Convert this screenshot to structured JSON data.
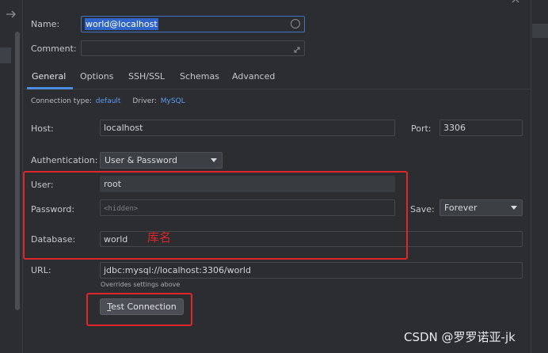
{
  "dialog": {
    "name_label": "Name:",
    "name_value": "world@localhost",
    "comment_label": "Comment:",
    "comment_value": ""
  },
  "tabs": [
    {
      "label": "General",
      "active": true
    },
    {
      "label": "Options",
      "active": false
    },
    {
      "label": "SSH/SSL",
      "active": false
    },
    {
      "label": "Schemas",
      "active": false
    },
    {
      "label": "Advanced",
      "active": false
    }
  ],
  "connection": {
    "type_label": "Connection type:",
    "type_value": "default",
    "driver_label": "Driver:",
    "driver_value": "MySQL"
  },
  "host": {
    "label": "Host:",
    "value": "localhost"
  },
  "port": {
    "label": "Port:",
    "value": "3306"
  },
  "auth": {
    "label": "Authentication:",
    "value": "User & Password"
  },
  "user": {
    "label": "User:",
    "value": "root"
  },
  "password": {
    "label": "Password:",
    "placeholder": "<hidden>"
  },
  "save": {
    "label": "Save:",
    "value": "Forever"
  },
  "database": {
    "label": "Database:",
    "value": "world",
    "annotation": "库名"
  },
  "url": {
    "label": "URL:",
    "value": "jdbc:mysql://localhost:3306/world",
    "hint": "Overrides settings above"
  },
  "test_button": {
    "mnemonic": "T",
    "rest": "est Connection"
  },
  "watermark": "CSDN @罗罗诺亚-jk",
  "colors": {
    "accent": "#5a9cf0",
    "annotation_red": "#e0262b",
    "background": "#2b2d30"
  },
  "icons": [
    "arrow-right-icon",
    "close-icon",
    "clear-circle-icon",
    "expand-icon",
    "dropdown-arrow-icon"
  ]
}
